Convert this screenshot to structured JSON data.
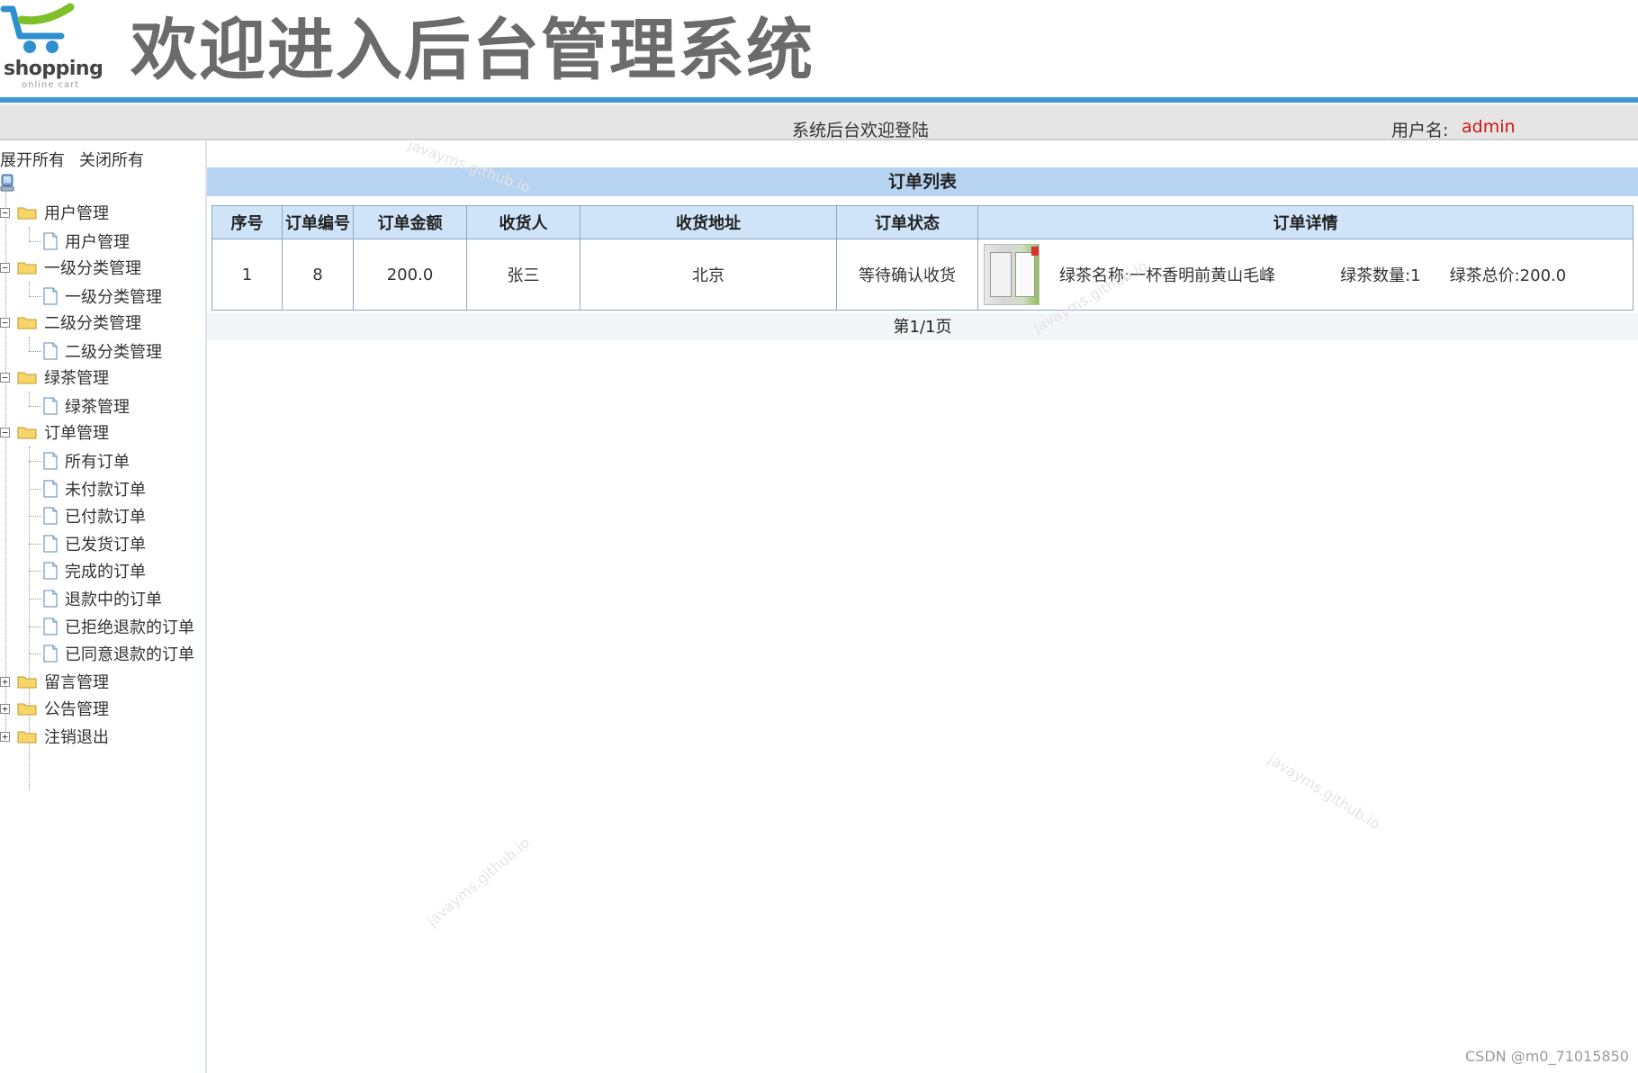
{
  "header": {
    "logo_text": "shopping",
    "logo_sub": "online cart",
    "title": "欢迎进入后台管理系统"
  },
  "welcome_bar": {
    "text": "系统后台欢迎登陆",
    "user_label": "用户名:",
    "user_value": "admin"
  },
  "sidebar": {
    "expand_all": "展开所有",
    "collapse_all": "关闭所有",
    "groups": [
      {
        "label": "用户管理",
        "toggle": "−",
        "children": [
          "用户管理"
        ]
      },
      {
        "label": "一级分类管理",
        "toggle": "−",
        "children": [
          "一级分类管理"
        ]
      },
      {
        "label": "二级分类管理",
        "toggle": "−",
        "children": [
          "二级分类管理"
        ]
      },
      {
        "label": "绿茶管理",
        "toggle": "−",
        "children": [
          "绿茶管理"
        ]
      },
      {
        "label": "订单管理",
        "toggle": "−",
        "children": [
          "所有订单",
          "未付款订单",
          "已付款订单",
          "已发货订单",
          "完成的订单",
          "退款中的订单",
          "已拒绝退款的订单",
          "已同意退款的订单"
        ]
      },
      {
        "label": "留言管理",
        "toggle": "+",
        "children": []
      },
      {
        "label": "公告管理",
        "toggle": "+",
        "children": []
      },
      {
        "label": "注销退出",
        "toggle": "+",
        "children": []
      }
    ]
  },
  "main": {
    "panel_title": "订单列表",
    "columns": [
      "序号",
      "订单编号",
      "订单金额",
      "收货人",
      "收货地址",
      "订单状态",
      "订单详情"
    ],
    "rows": [
      {
        "index": "1",
        "order_no": "8",
        "amount": "200.0",
        "receiver": "张三",
        "address": "北京",
        "status": "等待确认收货",
        "detail": {
          "name": "绿茶名称:一杯香明前黄山毛峰",
          "qty": "绿茶数量:1",
          "total": "绿茶总价:200.0"
        }
      }
    ],
    "pager": "第1/1页"
  },
  "watermarks": [
    "javayms.github.io",
    "javayms.github.io",
    "javayms.github.io",
    "javayms.github.io"
  ],
  "footer_credit": "CSDN @m0_71015850",
  "colors": {
    "header_line": "#3d9ad6",
    "panel_title_bg": "#b6d3f1",
    "table_header_bg": "#cfe4f8",
    "username": "#d21414"
  }
}
